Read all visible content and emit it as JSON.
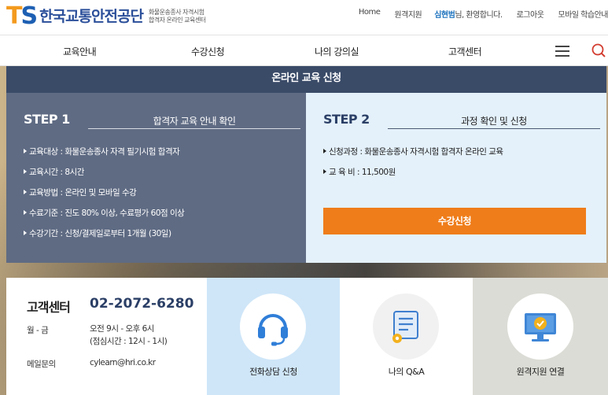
{
  "header": {
    "logo_ts_t": "T",
    "logo_ts_s": "S",
    "logo_name": "한국교통안전공단",
    "logo_sub_1": "화물운송종사 자격시험",
    "logo_sub_2": "합격자 온라인 교육센터",
    "util": {
      "home": "Home",
      "remote_support": "원격지원",
      "user_name": "심현범",
      "greeting": "님, 환영합니다.",
      "logout": "로그아웃",
      "mobile_guide": "모바일 학습안내"
    }
  },
  "nav": {
    "items": [
      {
        "label": "교육안내"
      },
      {
        "label": "수강신청"
      },
      {
        "label": "나의 강의실"
      },
      {
        "label": "고객센터"
      }
    ],
    "menu_icon": "hamburger-icon",
    "search_icon": "search-icon"
  },
  "apply": {
    "title": "온라인 교육 신청",
    "step1": {
      "no": "STEP 1",
      "title": "합격자 교육 안내 확인",
      "lines": [
        "교육대상 : 화물운송종사 자격 필기시험 합격자",
        "교육시간 : 8시간",
        "교육방법 : 온라인 및 모바일 수강",
        "수료기준 : 진도 80% 이상, 수료평가 60점 이상",
        "수강기간 : 신청/결제일로부터 1개월 (30일)"
      ]
    },
    "step2": {
      "no": "STEP 2",
      "title": "과정 확인 및 신청",
      "lines": [
        "신청과정 : 화물운송종사 자격시험 합격자 온라인 교육",
        "교 육 비 : 11,500원"
      ],
      "button": "수강신청"
    }
  },
  "customer": {
    "title": "고객센터",
    "phone": "02-2072-6280",
    "hours_label": "월 - 금",
    "hours_1": "오전 9시 - 오후 6시",
    "hours_2": "(점심시간 : 12시 - 1시)",
    "email_label": "메일문의",
    "email": "cylearn@hri.co.kr"
  },
  "cards": [
    {
      "label": "전화상담 신청",
      "icon": "headset-icon",
      "bg": "#cfe6f8"
    },
    {
      "label": "나의 Q&A",
      "icon": "document-icon",
      "bg": "#ffffff"
    },
    {
      "label": "원격지원 연결",
      "icon": "monitor-check-icon",
      "bg": "#dcdcd6"
    }
  ],
  "colors": {
    "title_bar": "#3a4b68",
    "step1_bg": "#5f6b83",
    "step2_bg": "#e4f1fb",
    "accent_orange": "#ef7d1a",
    "brand_blue": "#1d5fb3",
    "brand_orange": "#f39a1e"
  }
}
